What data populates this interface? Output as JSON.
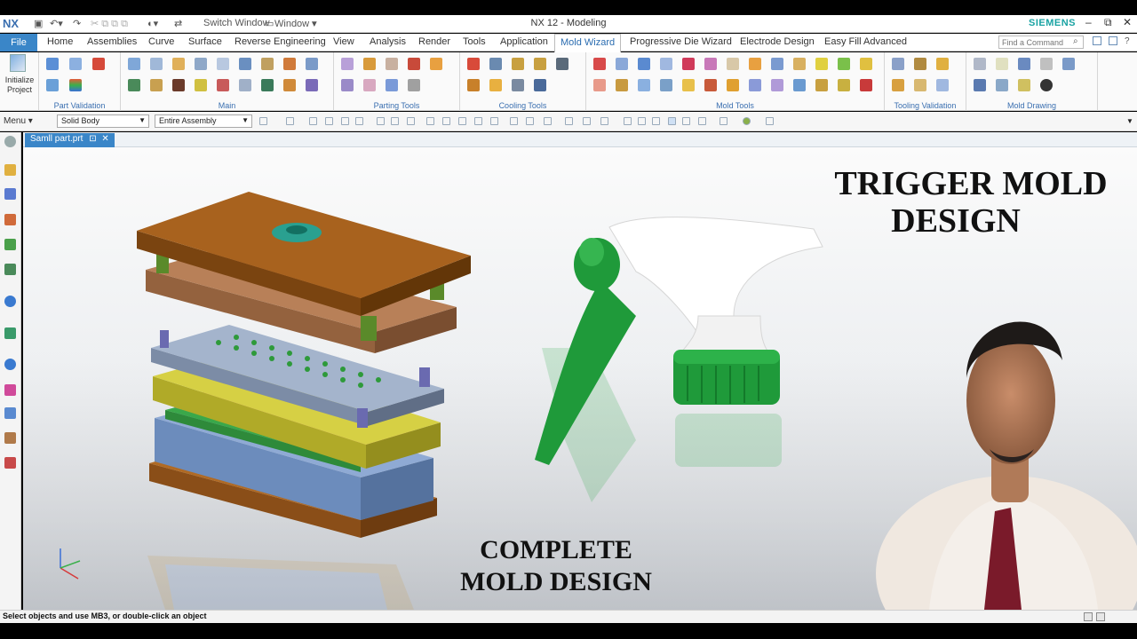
{
  "app": {
    "logo": "NX",
    "window_title": "NX 12 - Modeling",
    "brand": "SIEMENS",
    "switch_window": "Switch Window",
    "window_menu": "Window ▾"
  },
  "menubar": {
    "file": "File",
    "tabs": [
      "Home",
      "Assemblies",
      "Curve",
      "Surface",
      "Reverse Engineering",
      "View",
      "Analysis",
      "Render",
      "Tools",
      "Application",
      "Mold Wizard",
      "Progressive Die Wizard",
      "Electrode Design",
      "Easy Fill Advanced"
    ],
    "active_tab": "Mold Wizard",
    "find_placeholder": "Find a Command"
  },
  "ribbon": {
    "initialize_label": "Initialize Project",
    "groups": [
      "Part Validation",
      "Main",
      "Parting Tools",
      "Cooling Tools",
      "Mold Tools",
      "Tooling Validation",
      "Mold Drawing"
    ]
  },
  "selection_bar": {
    "menu_label": "Menu ▾",
    "filter_type": "Solid Body",
    "scope": "Entire Assembly"
  },
  "document": {
    "tab_label": "Samll part.prt"
  },
  "overlay": {
    "title_line1": "TRIGGER MOLD",
    "title_line2": "DESIGN",
    "subtitle_line1": "COMPLETE",
    "subtitle_line2": "MOLD DESIGN"
  },
  "status": {
    "message": "Select objects and use MB3, or double-click an object"
  },
  "colors": {
    "accent": "#3a86c8",
    "brand": "#1aa3a3",
    "mold_top": "#9a5a1a",
    "mold_blue": "#7c9cc8",
    "mold_yellow": "#c8c23a",
    "trigger_green": "#1f9a3a"
  }
}
